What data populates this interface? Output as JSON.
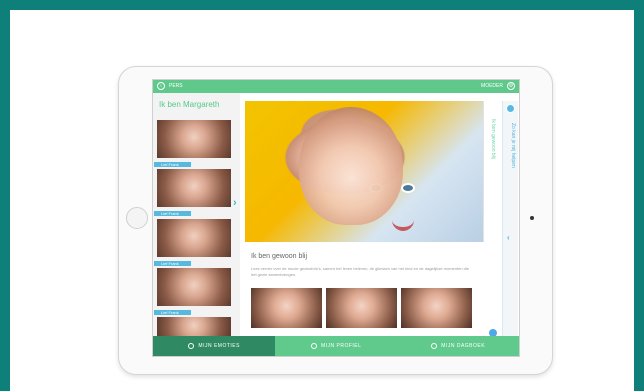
{
  "header": {
    "left_label": "PERS",
    "right_label": "MOEDER",
    "left_icon": "back-arrow-icon",
    "right_icon": "settings-icon"
  },
  "sidebar": {
    "title": "Ik ben Margareth",
    "items": [
      {
        "label": "Lief Frank"
      },
      {
        "label": "Lief Frank"
      },
      {
        "label": "Lief Frank"
      },
      {
        "label": "Lief Frank"
      }
    ]
  },
  "main": {
    "title": "Ik ben gewoon blij",
    "body": "Lees verder over de mooie gezinsfoto's, samen het leven beleven, de glimlach van het kind en de dagelijkse momenten die het gezin samenbrengen.",
    "right_vertical_text": "Ik ben gewoon blij",
    "strip_vertical_text": "Zo kan je mij helpen"
  },
  "bottom_nav": {
    "tabs": [
      {
        "label": "MIJN EMOTIES",
        "icon": "emotions-icon"
      },
      {
        "label": "MIJN PROFIEL",
        "icon": "profile-icon"
      },
      {
        "label": "MIJN DAGBOEK",
        "icon": "diary-icon"
      }
    ]
  },
  "colors": {
    "frame": "#0f7f7a",
    "green": "#5ec98a",
    "dark_green": "#2f8a63",
    "blue": "#58b9df"
  }
}
